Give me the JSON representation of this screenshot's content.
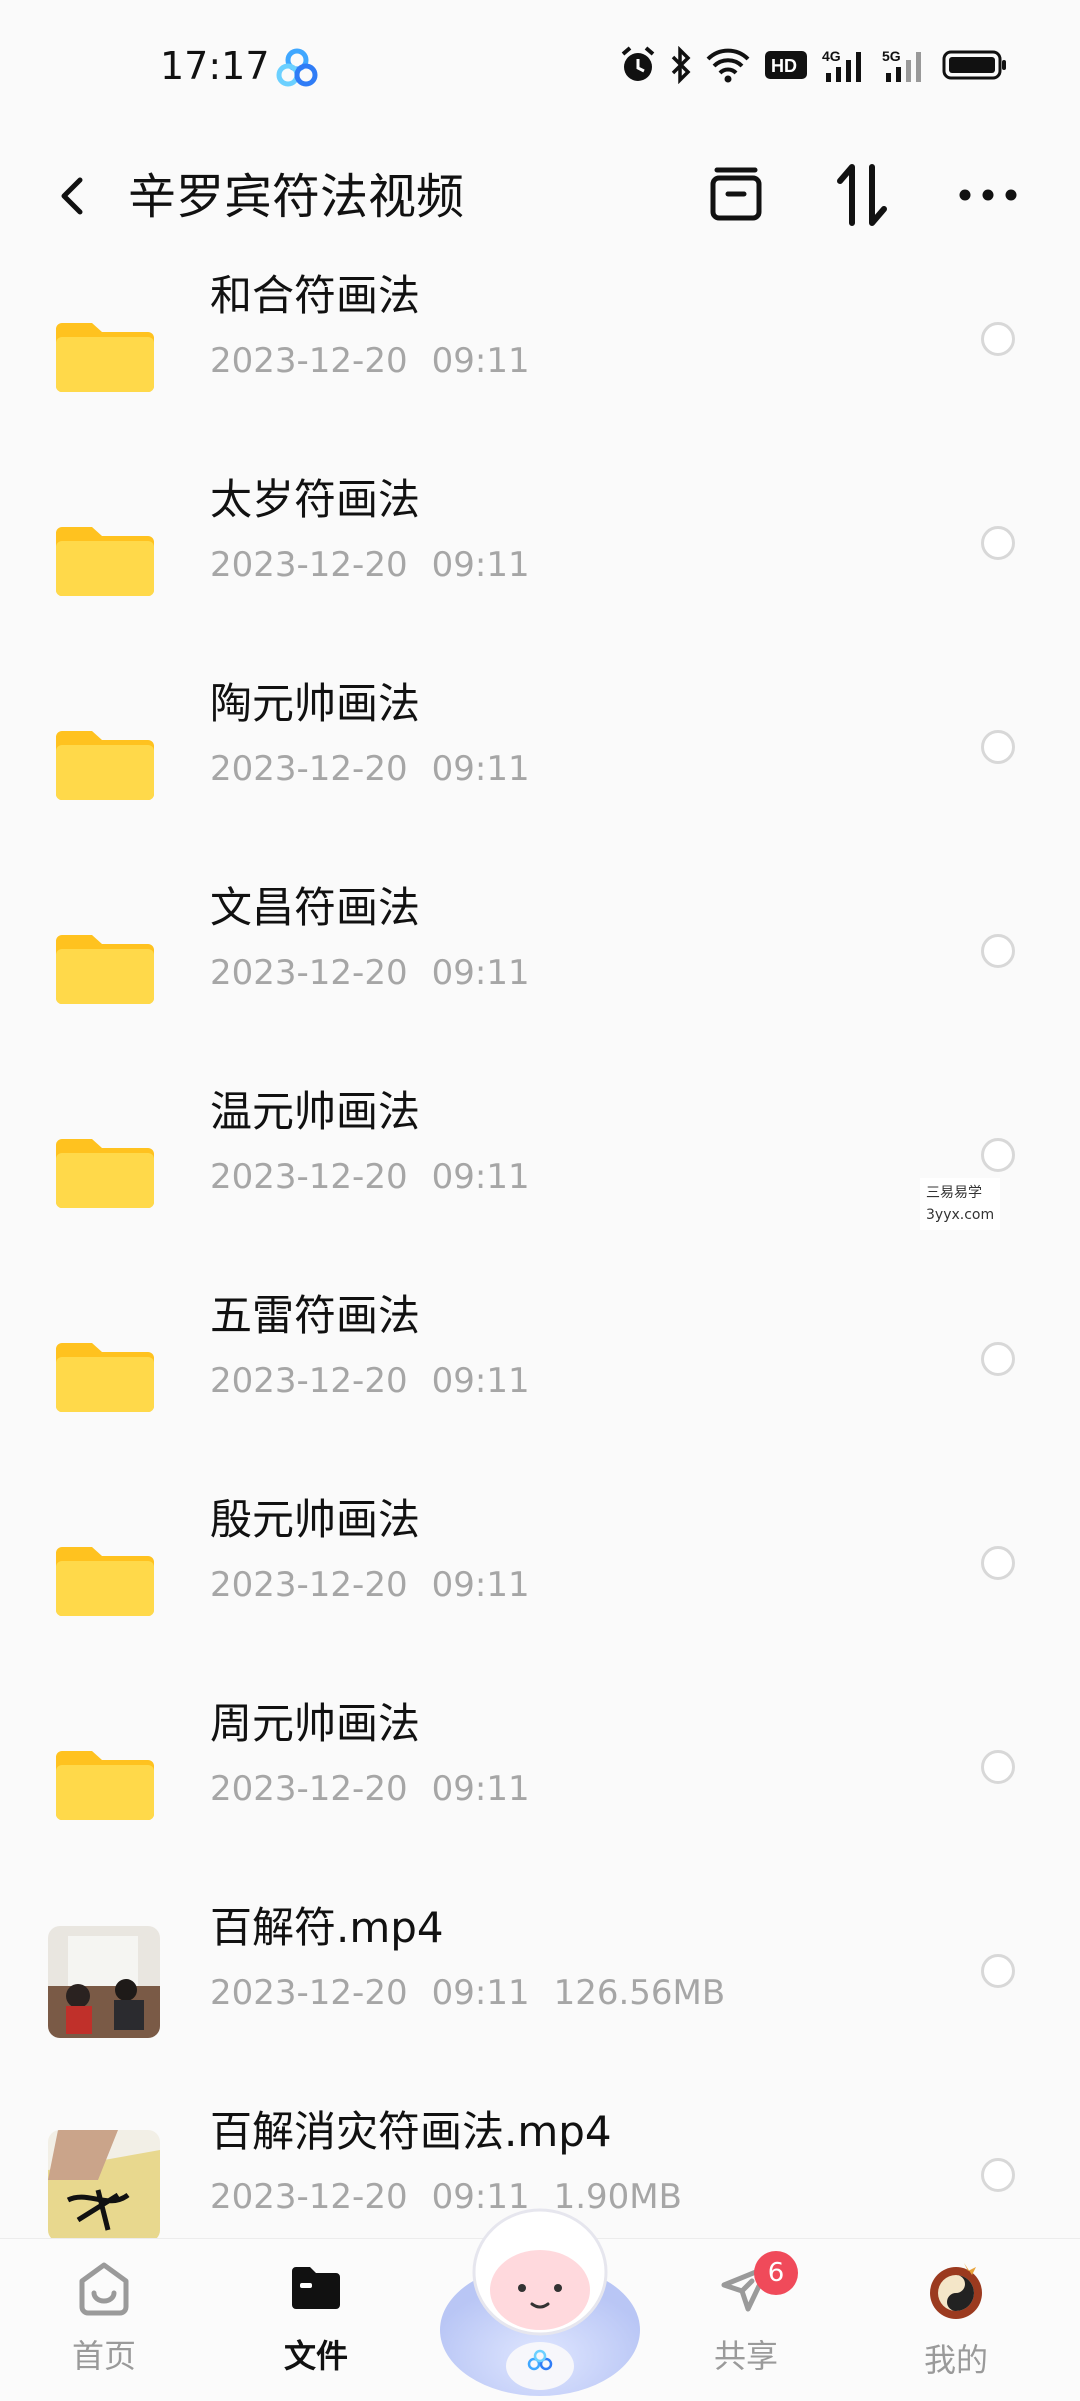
{
  "status_bar": {
    "time": "17:17",
    "icons": [
      "baidu-netdisk-icon",
      "alarm-icon",
      "bluetooth-icon",
      "wifi-icon",
      "hd-icon",
      "signal-4g-icon",
      "signal-5g-icon",
      "battery-icon"
    ],
    "hd_label": "HD",
    "net1": "4G",
    "net2": "5G"
  },
  "app_bar": {
    "title": "辛罗宾符法视频",
    "actions": [
      "select-all-icon",
      "sort-icon",
      "more-icon"
    ]
  },
  "files": [
    {
      "name": "和合符画法",
      "date": "2023-12-20",
      "time": "09:11",
      "size": "",
      "type": "folder"
    },
    {
      "name": "太岁符画法",
      "date": "2023-12-20",
      "time": "09:11",
      "size": "",
      "type": "folder"
    },
    {
      "name": "陶元帅画法",
      "date": "2023-12-20",
      "time": "09:11",
      "size": "",
      "type": "folder"
    },
    {
      "name": "文昌符画法",
      "date": "2023-12-20",
      "time": "09:11",
      "size": "",
      "type": "folder"
    },
    {
      "name": "温元帅画法",
      "date": "2023-12-20",
      "time": "09:11",
      "size": "",
      "type": "folder"
    },
    {
      "name": "五雷符画法",
      "date": "2023-12-20",
      "time": "09:11",
      "size": "",
      "type": "folder"
    },
    {
      "name": "殷元帅画法",
      "date": "2023-12-20",
      "time": "09:11",
      "size": "",
      "type": "folder"
    },
    {
      "name": "周元帅画法",
      "date": "2023-12-20",
      "time": "09:11",
      "size": "",
      "type": "folder"
    },
    {
      "name": "百解符.mp4",
      "date": "2023-12-20",
      "time": "09:11",
      "size": "126.56MB",
      "type": "video"
    },
    {
      "name": "百解消灾符画法.mp4",
      "date": "2023-12-20",
      "time": "09:11",
      "size": "1.90MB",
      "type": "video"
    }
  ],
  "watermark": {
    "line1": "三易易学",
    "line2": "3yyx.com"
  },
  "tab_bar": {
    "tabs": [
      {
        "label": "首页",
        "icon": "home-icon",
        "active": false
      },
      {
        "label": "文件",
        "icon": "folder-icon",
        "active": true
      },
      {
        "label": "",
        "icon": "mascot-icon",
        "active": false
      },
      {
        "label": "共享",
        "icon": "share-plane-icon",
        "active": false,
        "badge": "6"
      },
      {
        "label": "我的",
        "icon": "avatar-icon",
        "active": false
      }
    ]
  },
  "colors": {
    "folder": "#FFD23C",
    "accent_badge": "#F04A5A",
    "meta_text": "#A6A6A6"
  }
}
